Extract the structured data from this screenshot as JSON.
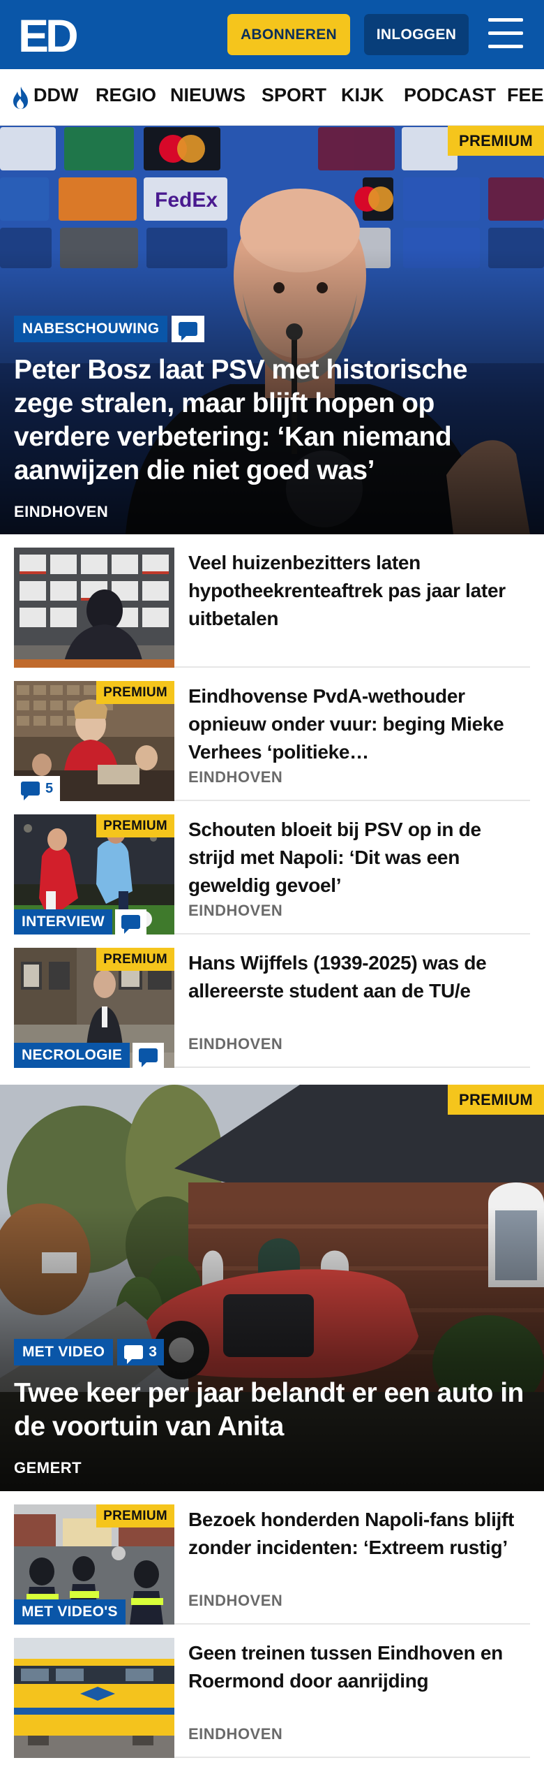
{
  "header": {
    "logo_text": "ED",
    "subscribe_label": "ABONNEREN",
    "login_label": "INLOGGEN"
  },
  "nav": {
    "items": [
      "DDW",
      "REGIO",
      "NIEUWS",
      "SPORT",
      "KIJK",
      "PODCAST",
      "FEE"
    ]
  },
  "colors": {
    "brand_blue": "#0a56a8",
    "premium_yellow": "#f5c51c",
    "location_gray": "#6a6a6a"
  },
  "hero1": {
    "premium": "PREMIUM",
    "tag": "NABESCHOUWING",
    "has_comments_icon": true,
    "title": "Peter Bosz laat PSV met historische zege stralen, maar blijft hopen op verdere verbetering: ‘Kan niemand aanwijzen die niet goed was’",
    "location": "EINDHOVEN"
  },
  "list1": [
    {
      "title": "Veel huizenbezitters laten hypotheekrenteaftrek pas jaar later uitbetalen",
      "location": "",
      "premium": "",
      "tag": "",
      "comments": ""
    },
    {
      "title": "Eindhovense PvdA-wethouder opnieuw onder vuur: beging Mieke Verhees ‘politieke…",
      "location": "EINDHOVEN",
      "premium": "PREMIUM",
      "tag": "",
      "comments": "5"
    },
    {
      "title": "Schouten bloeit bij PSV op in de strijd met Napoli: ‘Dit was een geweldig gevoel’",
      "location": "EINDHOVEN",
      "premium": "PREMIUM",
      "tag": "INTERVIEW",
      "comments": ""
    },
    {
      "title": "Hans Wijffels (1939-2025) was de allereerste student aan de TU/e",
      "location": "EINDHOVEN",
      "premium": "PREMIUM",
      "tag": "NECROLOGIE",
      "comments": ""
    }
  ],
  "hero2": {
    "premium": "PREMIUM",
    "tag": "MET VIDEO",
    "comments": "3",
    "title": "Twee keer per jaar belandt er een auto in de voortuin van Anita",
    "location": "GEMERT"
  },
  "list2": [
    {
      "title": "Bezoek honderden Napoli-fans blijft zonder incidenten: ‘Extreem rustig’",
      "location": "EINDHOVEN",
      "premium": "PREMIUM",
      "tag": "MET VIDEO'S"
    },
    {
      "title": "Geen treinen tussen Eindhoven en Roermond door aanrijding",
      "location": "EINDHOVEN",
      "premium": "",
      "tag": ""
    }
  ]
}
